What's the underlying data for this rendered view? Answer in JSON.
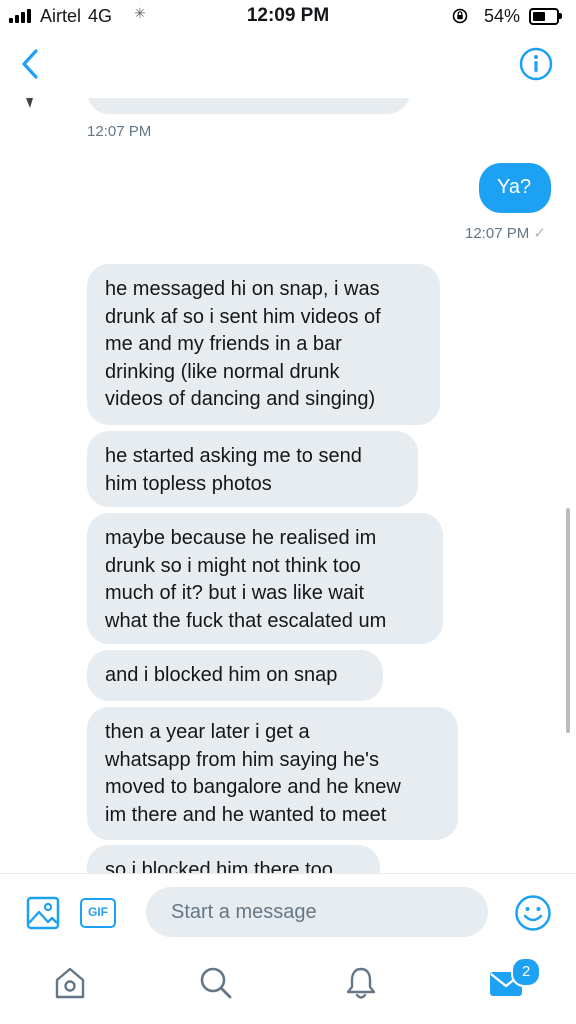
{
  "status_bar": {
    "carrier": "Airtel",
    "network": "4G",
    "time": "12:09 PM",
    "battery": "54%",
    "battery_level": 0.54
  },
  "header": {
    "back_icon": "chevron-left-icon",
    "info_icon": "info-icon"
  },
  "conversation": {
    "messages": [
      {
        "side": "out",
        "text": "Ya?"
      },
      {
        "side": "in",
        "text": "he messaged hi on snap, i was\ndrunk af so i sent him videos of\nme and my friends in a bar\ndrinking (like normal drunk\nvideos of dancing and singing)"
      },
      {
        "side": "in",
        "text": "he started asking me to send\nhim topless photos"
      },
      {
        "side": "in",
        "text": "maybe because he realised im\ndrunk so i might not think too\nmuch of it? but i was like wait\nwhat the fuck that escalated um"
      },
      {
        "side": "in",
        "text": "and i blocked him on snap"
      },
      {
        "side": "in",
        "text": "then a year later i get a\nwhatsapp from him saying he's\nmoved to bangalore and he knew\nim there and he wanted to meet"
      },
      {
        "side": "in",
        "text": "so i blocked him there too"
      }
    ],
    "timestamps": [
      "12:07 PM",
      "12:07 PM"
    ],
    "read_mark": "✓"
  },
  "composer": {
    "placeholder": "Start a message",
    "gif_label": "GIF"
  },
  "tabbar": {
    "messages_badge": "2"
  },
  "colors": {
    "accent": "#1da1f2",
    "incoming_bubble": "#e6ecf0",
    "timestamp": "#657786"
  }
}
